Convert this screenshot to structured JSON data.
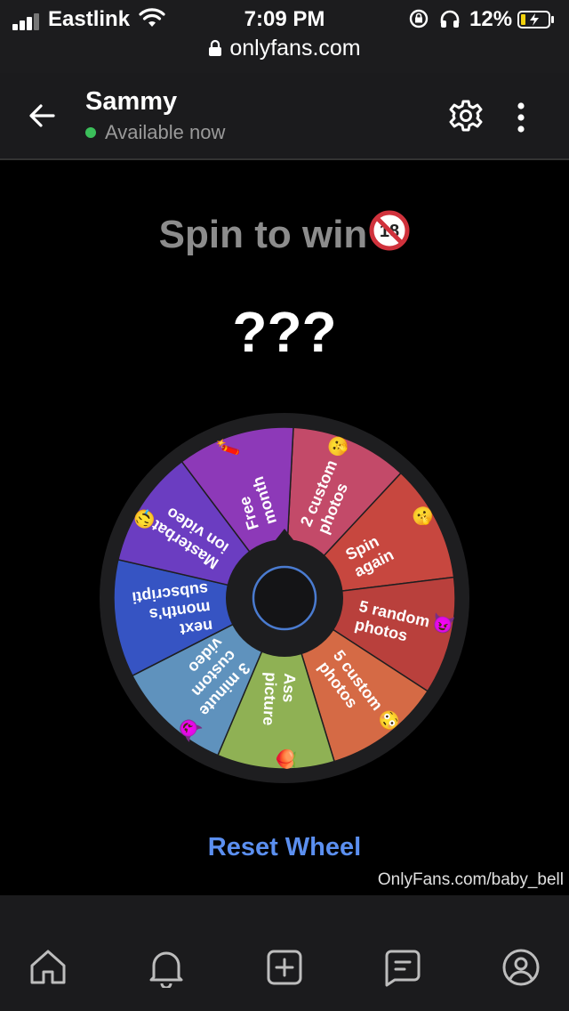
{
  "status_bar": {
    "carrier": "Eastlink",
    "time": "7:09 PM",
    "battery_percent": "12%",
    "url": "onlyfans.com"
  },
  "chat": {
    "back_icon": "back-arrow-icon",
    "contact_name": "Sammy",
    "presence": "Available now",
    "presence_color": "#3bbf5a",
    "settings_icon": "gear-icon",
    "more_icon": "vertical-dots-icon"
  },
  "game": {
    "title": "Spin to win",
    "title_icon": "no-under-18-icon",
    "result": "???",
    "reset_label": "Reset Wheel",
    "reset_color": "#5b8ff0",
    "segments": [
      {
        "lines": [
          "2 custom",
          "photos"
        ],
        "emoji": "🤫",
        "color": "#c34a69"
      },
      {
        "lines": [
          "Spin",
          "again"
        ],
        "emoji": "🤫",
        "color": "#c7473f"
      },
      {
        "lines": [
          "5 random",
          "photos"
        ],
        "emoji": "😈",
        "color": "#b9403c"
      },
      {
        "lines": [
          "5 custom",
          "photos"
        ],
        "emoji": "😳",
        "color": "#d56a45"
      },
      {
        "lines": [
          "Ass",
          "picture"
        ],
        "emoji": "🍑",
        "color": "#8fb154"
      },
      {
        "lines": [
          "3 minute",
          "custom",
          "video"
        ],
        "emoji": "😈",
        "color": "#5f92bd"
      },
      {
        "lines": [
          "next",
          "month's",
          "subscripti"
        ],
        "emoji": "",
        "color": "#3654c3"
      },
      {
        "lines": [
          "Masterbat",
          "ion video"
        ],
        "emoji": "🤤",
        "color": "#6b3dc1"
      },
      {
        "lines": [
          "Free",
          "month"
        ],
        "emoji": "🧨",
        "color": "#8d39b8"
      }
    ]
  },
  "watermark": "OnlyFans.com/baby_bell",
  "tab_bar": [
    {
      "name": "home",
      "icon": "home-icon"
    },
    {
      "name": "notifications",
      "icon": "bell-icon"
    },
    {
      "name": "new-post",
      "icon": "plus-square-icon"
    },
    {
      "name": "messages",
      "icon": "message-icon"
    },
    {
      "name": "profile",
      "icon": "profile-icon"
    }
  ]
}
